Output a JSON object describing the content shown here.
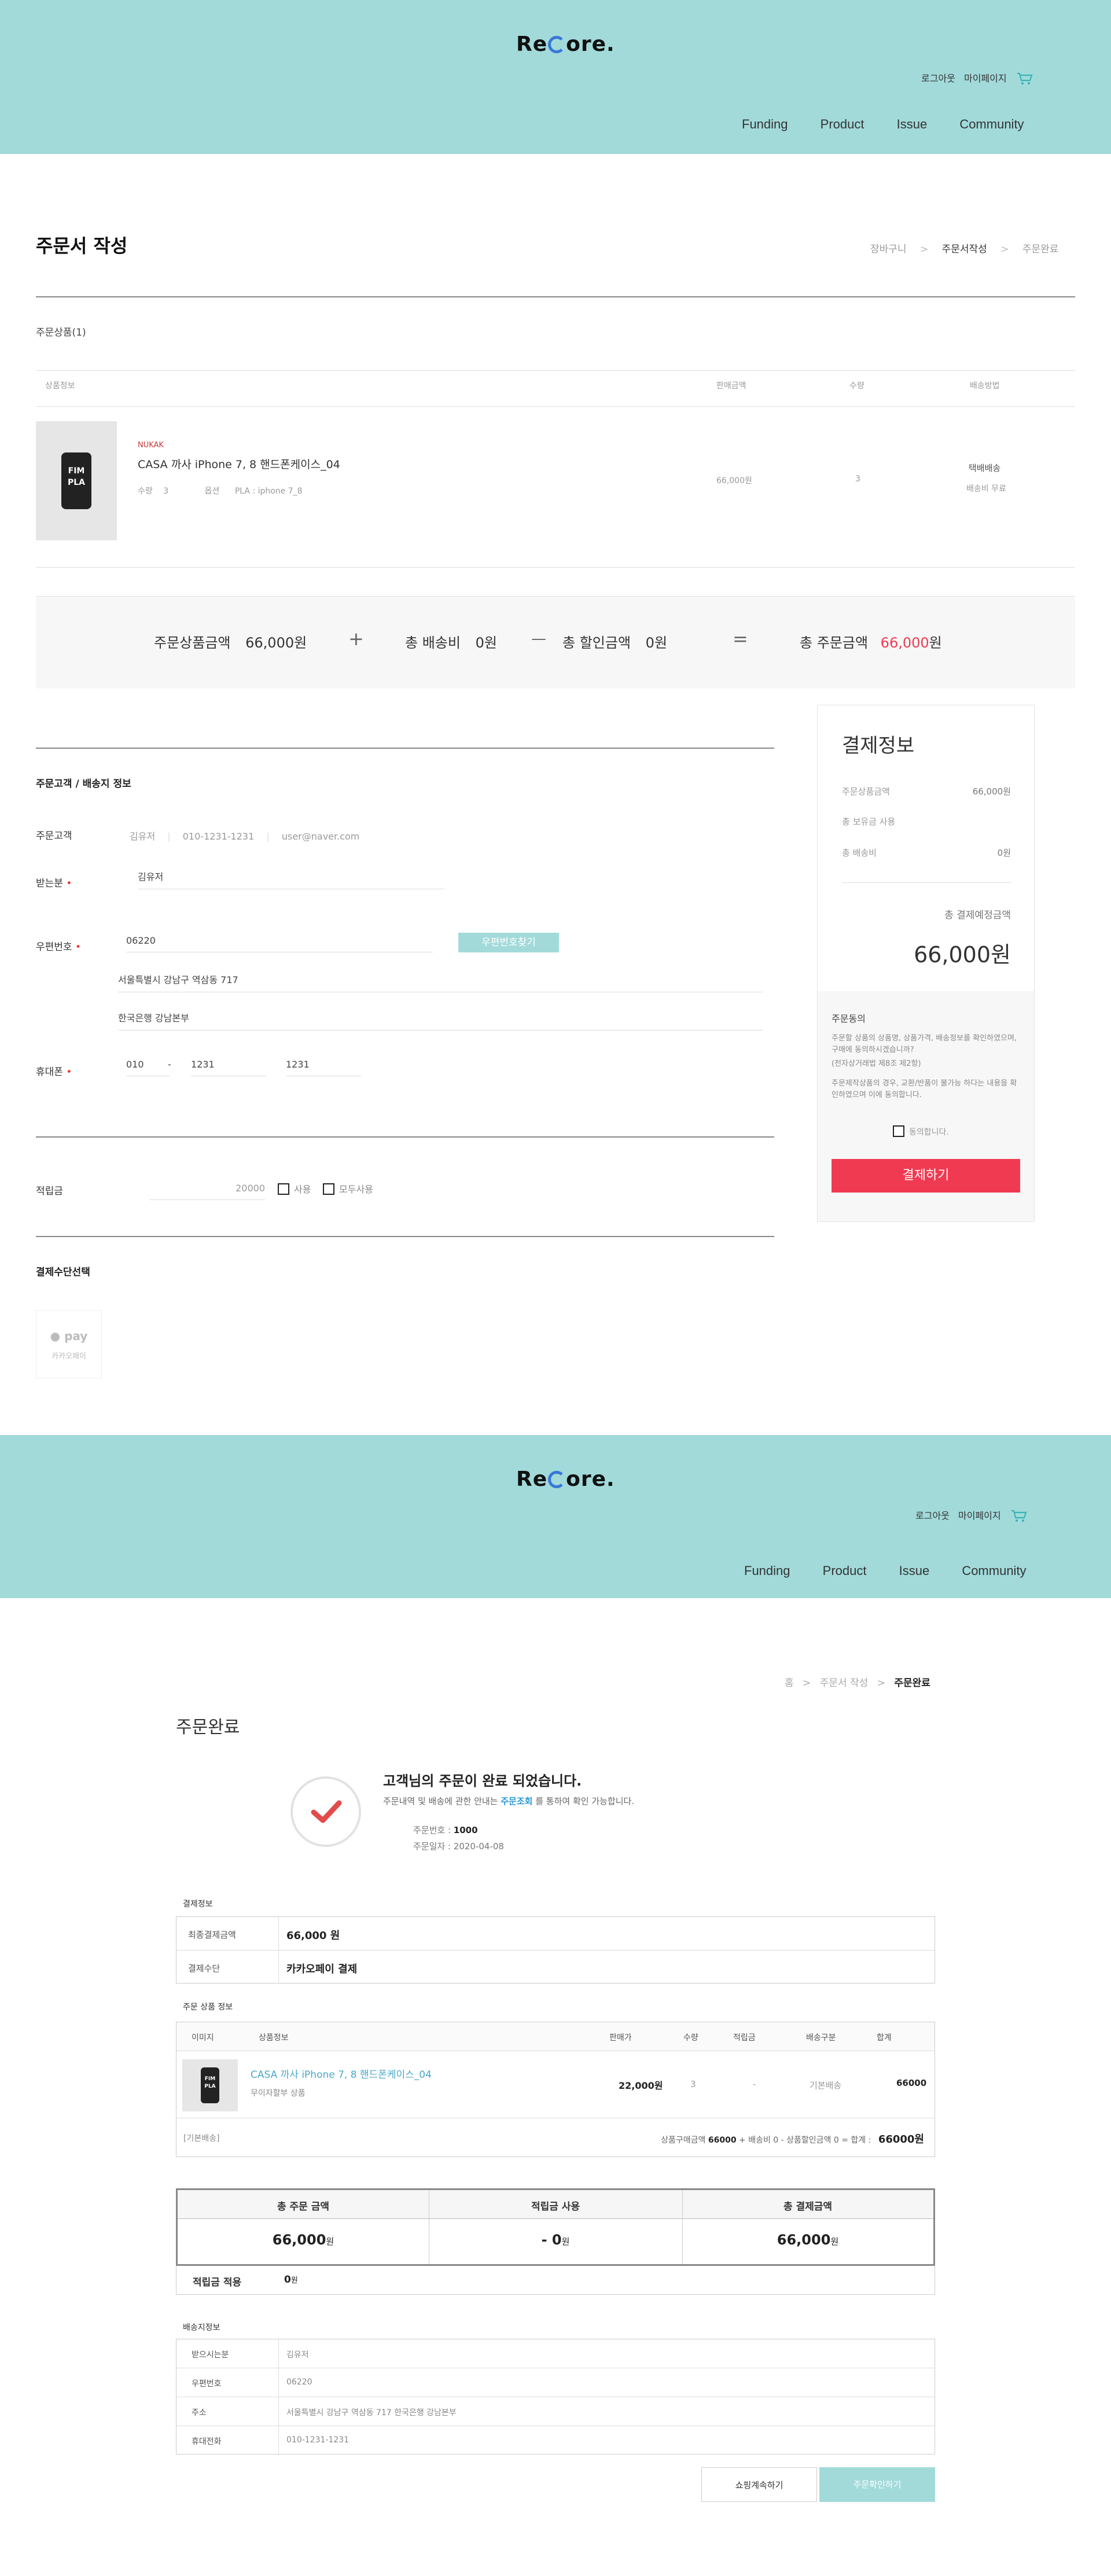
{
  "brand": {
    "logo_pre": "Re",
    "logo_post": "ore.",
    "accent": "#a2dada",
    "logo_ring": "#3a76d8",
    "price_red": "#f03a52"
  },
  "header": {
    "login": "로그아웃",
    "mypage": "마이페이지",
    "nav": [
      "Funding",
      "Product",
      "Issue",
      "Community"
    ]
  },
  "order": {
    "title": "주문서 작성",
    "steps": [
      "장바구니",
      "주문서작성",
      "주문완료"
    ],
    "products_title": "주문상품(1)",
    "table_headers": [
      "상품정보",
      "판매금액",
      "수량",
      "배송방법"
    ],
    "product": {
      "brand": "NUKAK",
      "name": "CASA 까사 iPhone 7, 8 핸드폰케이스_04",
      "qty_label": "수량",
      "qty": "3",
      "option_label": "옵션",
      "option": "PLA : iphone 7_8",
      "price": "66,000원",
      "count": "3",
      "ship": "택배배송",
      "ship_fee": "배송비 무료",
      "thumb_text1": "FIM",
      "thumb_text2": "PLA"
    },
    "summary": {
      "items_label": "주문상품금액",
      "items_value": "66,000원",
      "plus": "+",
      "ship_label": "총 배송비",
      "ship_value": "0원",
      "minus": "—",
      "disc_label": "총 할인금액",
      "disc_value": "0원",
      "equals": "=",
      "total_label": "총 주문금액",
      "total_value": "66,000",
      "total_unit": "원"
    },
    "customer": {
      "section": "주문고객 / 배송지 정보",
      "customer_label": "주문고객",
      "name": "김유저",
      "phone": "010-1231-1231",
      "email": "user@naver.com",
      "receiver_label": "받는분",
      "receiver": "김유저",
      "zip_label": "우편번호",
      "zip": "06220",
      "zip_btn": "우편번호찾기",
      "addr1": "서울특별시 강남구 역삼동 717",
      "addr2": "한국은행 강남본부",
      "mobile_label": "휴대폰",
      "mobile1": "010",
      "dash": "-",
      "mobile2": "1231",
      "mobile3": "1231"
    },
    "points": {
      "label": "적립금",
      "value": "20000",
      "use": "사용",
      "use_all": "모두사용"
    },
    "payment": {
      "section": "결제수단선택",
      "kakao_top": "pay",
      "kakao_label": "카카오페이"
    },
    "side": {
      "title": "결제정보",
      "items_label": "주문상품금액",
      "items_value": "66,000원",
      "point_label": "총 보유금 사용",
      "ship_label": "총 배송비",
      "ship_value": "0원",
      "total_label": "총 결제예정금액",
      "total_value": "66,000원",
      "agree_title": "주문동의",
      "agree_text1": "주문할 상품의 상품명, 상품가격, 배송정보를 확인하였으며, 구매에 동의하시겠습니까?",
      "agree_text2": "(전자상거래법 제8조 제2항)",
      "agree_text3": "주문제작상품의 경우, 교환/반품이 불가능 하다는 내용을 확인하였으며 이에 동의합니다.",
      "agree_check": "동의합니다.",
      "pay_btn": "결제하기"
    }
  },
  "complete": {
    "breadcrumb": [
      "홈",
      "주문서 작성",
      "주문완료"
    ],
    "title": "주문완료",
    "msg": "고객님의 주문이 완료 되었습니다.",
    "sub_pre": "주문내역 및 배송에 관한 안내는 ",
    "sub_link": "주문조회",
    "sub_post": " 를 통하여 확인 가능합니다.",
    "order_no_label": "주문번호 : ",
    "order_no": "1000",
    "order_date_label": "주문일자 : ",
    "order_date": "2020-04-08",
    "pay_section": "결제정보",
    "final_label": "최종결제금액",
    "final_value": "66,000 원",
    "method_label": "결제수단",
    "method_value": "카카오페이 결제",
    "goods_section": "주문 상품 정보",
    "goods_headers": [
      "이미지",
      "상품정보",
      "판매가",
      "수량",
      "적립금",
      "배송구분",
      "합계"
    ],
    "goods_row": {
      "name": "CASA 까사 iPhone 7, 8 핸드폰케이스_04",
      "ship_type": "무이자할부 상품",
      "price": "22,000원",
      "qty": "3",
      "point": "-",
      "ship": "기본배송",
      "sum": "66000"
    },
    "basic_ship": "[기본배송]",
    "sum_line_pre": "상품구매금액 ",
    "sum_line_amt": "66000",
    "sum_line_mid": " + 배송비 0 - 상품할인금액 0 = 합계 : ",
    "sum_line_total": "66000원",
    "totals_headers": [
      "총 주문 금액",
      "적립금 사용",
      "총 결제금액"
    ],
    "totals_values": [
      "66,000",
      "- 0",
      "66,000"
    ],
    "totals_unit": "원",
    "point_row_label": "적립금 적용",
    "point_row_value": "0",
    "point_row_unit": "원",
    "ship_section": "배송지정보",
    "ship_rows": [
      {
        "label": "받으시는분",
        "value": "김유저"
      },
      {
        "label": "우편번호",
        "value": "06220"
      },
      {
        "label": "주소",
        "value": "서울특별시 강남구 역삼동 717 한국은행 강남본부"
      },
      {
        "label": "휴대전화",
        "value": "010-1231-1231"
      }
    ],
    "btn_continue": "쇼핑계속하기",
    "btn_orders": "주문확인하기"
  }
}
